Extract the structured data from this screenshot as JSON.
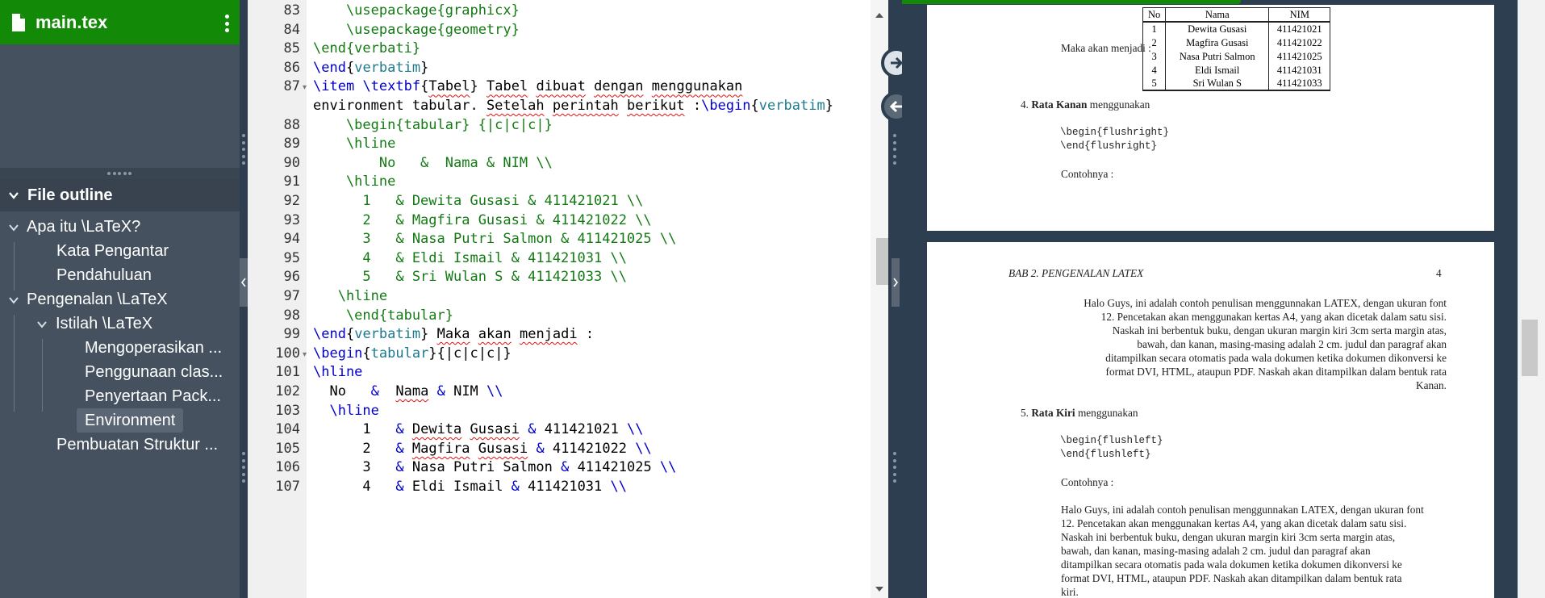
{
  "sidebar": {
    "file_name": "main.tex",
    "outline_title": "File outline",
    "outline_items": [
      {
        "label": "Apa itu \\LaTeX?"
      },
      {
        "label": "Kata Pengantar"
      },
      {
        "label": "Pendahuluan"
      },
      {
        "label": "Pengenalan \\LaTeX"
      },
      {
        "label": "Istilah \\LaTeX"
      },
      {
        "label": "Mengoperasikan ..."
      },
      {
        "label": "Penggunaan clas..."
      },
      {
        "label": "Penyertaan Pack..."
      },
      {
        "label": "Environment"
      },
      {
        "label": "Pembuatan Struktur ..."
      }
    ]
  },
  "editor": {
    "line_numbers": [
      "83",
      "84",
      "85",
      "86",
      "87",
      "",
      "88",
      "89",
      "90",
      "91",
      "92",
      "93",
      "94",
      "95",
      "96",
      "97",
      "98",
      "99",
      "100",
      "101",
      "102",
      "103",
      "104",
      "105",
      "106",
      "107"
    ],
    "lines": [
      {
        "segs": [
          {
            "c": "g",
            "t": "    \\usepackage{graphicx}"
          }
        ]
      },
      {
        "segs": [
          {
            "c": "g",
            "t": "    \\usepackage{geometry}"
          }
        ]
      },
      {
        "segs": [
          {
            "c": "g",
            "t": "\\end{verbati}"
          }
        ]
      },
      {
        "segs": [
          {
            "c": "k",
            "t": "\\end"
          },
          {
            "c": "",
            "t": "{"
          },
          {
            "c": "t",
            "t": "verbatim"
          },
          {
            "c": "",
            "t": "}"
          }
        ]
      },
      {
        "segs": [
          {
            "c": "k",
            "t": "\\item"
          },
          {
            "c": "",
            "t": " "
          },
          {
            "c": "k",
            "t": "\\textbf"
          },
          {
            "c": "",
            "t": "{"
          },
          {
            "c": "sp",
            "t": "Tabel"
          },
          {
            "c": "",
            "t": "} "
          },
          {
            "c": "sp",
            "t": "Tabel"
          },
          {
            "c": "",
            "t": " "
          },
          {
            "c": "sp",
            "t": "dibuat"
          },
          {
            "c": "",
            "t": " "
          },
          {
            "c": "sp",
            "t": "dengan"
          },
          {
            "c": "",
            "t": " "
          },
          {
            "c": "sp",
            "t": "menggunakan"
          }
        ]
      },
      {
        "segs": [
          {
            "c": "",
            "t": "environment tabular. "
          },
          {
            "c": "sp",
            "t": "Setelah"
          },
          {
            "c": "",
            "t": " "
          },
          {
            "c": "sp",
            "t": "perintah"
          },
          {
            "c": "",
            "t": " "
          },
          {
            "c": "sp",
            "t": "berikut"
          },
          {
            "c": "",
            "t": " :"
          },
          {
            "c": "k",
            "t": "\\begin"
          },
          {
            "c": "",
            "t": "{"
          },
          {
            "c": "t",
            "t": "verbatim"
          },
          {
            "c": "",
            "t": "}"
          }
        ]
      },
      {
        "segs": [
          {
            "c": "g",
            "t": "    \\begin{tabular} {|c|c|c|}"
          }
        ]
      },
      {
        "segs": [
          {
            "c": "g",
            "t": "    \\hline"
          }
        ]
      },
      {
        "segs": [
          {
            "c": "g",
            "t": "        No   &  Nama & NIM \\\\"
          }
        ]
      },
      {
        "segs": [
          {
            "c": "g",
            "t": "    \\hline"
          }
        ]
      },
      {
        "segs": [
          {
            "c": "g",
            "t": "      1   & Dewita Gusasi & 411421021 \\\\"
          }
        ]
      },
      {
        "segs": [
          {
            "c": "g",
            "t": "      2   & Magfira Gusasi & 411421022 \\\\"
          }
        ]
      },
      {
        "segs": [
          {
            "c": "g",
            "t": "      3   & Nasa Putri Salmon & 411421025 \\\\"
          }
        ]
      },
      {
        "segs": [
          {
            "c": "g",
            "t": "      4   & Eldi Ismail & 411421031 \\\\"
          }
        ]
      },
      {
        "segs": [
          {
            "c": "g",
            "t": "      5   & Sri Wulan S & 411421033 \\\\"
          }
        ]
      },
      {
        "segs": [
          {
            "c": "g",
            "t": "   \\hline"
          }
        ]
      },
      {
        "segs": [
          {
            "c": "g",
            "t": "    \\end{tabular}"
          }
        ]
      },
      {
        "segs": [
          {
            "c": "k",
            "t": "\\end"
          },
          {
            "c": "",
            "t": "{"
          },
          {
            "c": "t",
            "t": "verbatim"
          },
          {
            "c": "",
            "t": "} "
          },
          {
            "c": "sp",
            "t": "Maka"
          },
          {
            "c": "",
            "t": " "
          },
          {
            "c": "sp",
            "t": "akan"
          },
          {
            "c": "",
            "t": " "
          },
          {
            "c": "sp",
            "t": "menjadi"
          },
          {
            "c": "",
            "t": " :"
          }
        ]
      },
      {
        "segs": [
          {
            "c": "k",
            "t": "\\begin"
          },
          {
            "c": "",
            "t": "{"
          },
          {
            "c": "t",
            "t": "tabular"
          },
          {
            "c": "",
            "t": "}{|c|c|c|}"
          }
        ]
      },
      {
        "segs": [
          {
            "c": "k",
            "t": "\\hline"
          }
        ]
      },
      {
        "segs": [
          {
            "c": "",
            "t": "  No   "
          },
          {
            "c": "k",
            "t": "&"
          },
          {
            "c": "",
            "t": "  "
          },
          {
            "c": "sp",
            "t": "Nama"
          },
          {
            "c": "",
            "t": " "
          },
          {
            "c": "k",
            "t": "&"
          },
          {
            "c": "",
            "t": " NIM "
          },
          {
            "c": "k",
            "t": "\\\\"
          }
        ]
      },
      {
        "segs": [
          {
            "c": "",
            "t": "  "
          },
          {
            "c": "k",
            "t": "\\hline"
          }
        ]
      },
      {
        "segs": [
          {
            "c": "",
            "t": "      1   "
          },
          {
            "c": "k",
            "t": "&"
          },
          {
            "c": "",
            "t": " "
          },
          {
            "c": "sp",
            "t": "Dewita"
          },
          {
            "c": "",
            "t": " "
          },
          {
            "c": "sp",
            "t": "Gusasi"
          },
          {
            "c": "",
            "t": " "
          },
          {
            "c": "k",
            "t": "&"
          },
          {
            "c": "",
            "t": " 411421021 "
          },
          {
            "c": "k",
            "t": "\\\\"
          }
        ]
      },
      {
        "segs": [
          {
            "c": "",
            "t": "      2   "
          },
          {
            "c": "k",
            "t": "&"
          },
          {
            "c": "",
            "t": " "
          },
          {
            "c": "sp",
            "t": "Magfira"
          },
          {
            "c": "",
            "t": " "
          },
          {
            "c": "sp",
            "t": "Gusasi"
          },
          {
            "c": "",
            "t": " "
          },
          {
            "c": "k",
            "t": "&"
          },
          {
            "c": "",
            "t": " 411421022 "
          },
          {
            "c": "k",
            "t": "\\\\"
          }
        ]
      },
      {
        "segs": [
          {
            "c": "",
            "t": "      3   "
          },
          {
            "c": "k",
            "t": "&"
          },
          {
            "c": "",
            "t": " Nasa Putri Salmon "
          },
          {
            "c": "k",
            "t": "&"
          },
          {
            "c": "",
            "t": " 411421025 "
          },
          {
            "c": "k",
            "t": "\\\\"
          }
        ]
      },
      {
        "segs": [
          {
            "c": "",
            "t": "      4   "
          },
          {
            "c": "k",
            "t": "&"
          },
          {
            "c": "",
            "t": " Eldi Ismail "
          },
          {
            "c": "k",
            "t": "&"
          },
          {
            "c": "",
            "t": " 411421031 "
          },
          {
            "c": "k",
            "t": "\\\\"
          }
        ]
      }
    ]
  },
  "pdf": {
    "page1": {
      "intro": "Maka akan menjadi :",
      "table_header": [
        "No",
        "Nama",
        "NIM"
      ],
      "table_rows": [
        [
          "1",
          "Dewita Gusasi",
          "411421021"
        ],
        [
          "2",
          "Magfira Gusasi",
          "411421022"
        ],
        [
          "3",
          "Nasa Putri Salmon",
          "411421025"
        ],
        [
          "4",
          "Eldi Ismail",
          "411421031"
        ],
        [
          "5",
          "Sri Wulan S",
          "411421033"
        ]
      ],
      "item4_num": "4.",
      "item4_bold": "Rata Kanan",
      "item4_rest": "menggunakan",
      "code1": "\\begin{flushright}",
      "code2": "\\end{flushright}",
      "contoh": "Contohnya :"
    },
    "page2": {
      "header_left": "BAB 2.  PENGENALAN LATEX",
      "header_right": "4",
      "right_para": [
        "Halo Guys, ini adalah contoh penulisan menggunnakan LATEX, dengan ukuran font",
        "12. Pencetakan akan menggunakan kertas A4, yang akan dicetak dalam satu sisi.",
        "Naskah ini berbentuk buku, dengan ukuran margin kiri 3cm serta margin atas,",
        "bawah, dan kanan, masing-masing adalah 2 cm. judul dan paragraf akan",
        "ditampilkan secara otomatis pada wala dokumen ketika dokumen dikonversi ke",
        "format DVI, HTML, ataupun PDF. Naskah akan ditampilkan dalam bentuk rata",
        "Kanan."
      ],
      "item5_num": "5.",
      "item5_bold": "Rata Kiri",
      "item5_rest": "menggunakan",
      "code1": "\\begin{flushleft}",
      "code2": "\\end{flushleft}",
      "contoh": "Contohnya :",
      "left_para": [
        "Halo Guys, ini adalah contoh penulisan menggunnakan LATEX, dengan ukuran font",
        "12. Pencetakan akan menggunakan kertas A4, yang akan dicetak dalam satu sisi.",
        "Naskah ini berbentuk buku, dengan ukuran margin kiri 3cm serta margin atas,",
        "bawah, dan kanan, masing-masing adalah 2 cm. judul dan paragraf akan",
        "ditampilkan secara otomatis pada wala dokumen ketika dokumen dikonversi ke",
        "format DVI, HTML, ataupun PDF. Naskah akan ditampilkan dalam bentuk rata",
        "kiri."
      ]
    }
  },
  "colors": {
    "brand_green": "#138a07",
    "sidebar_bg": "#45515f",
    "panel_bg": "#2c3e50",
    "latex_command": "#0000cc",
    "verbatim_text": "#137a13",
    "env_name": "#1b7a8c",
    "spellcheck": "#e01010"
  }
}
